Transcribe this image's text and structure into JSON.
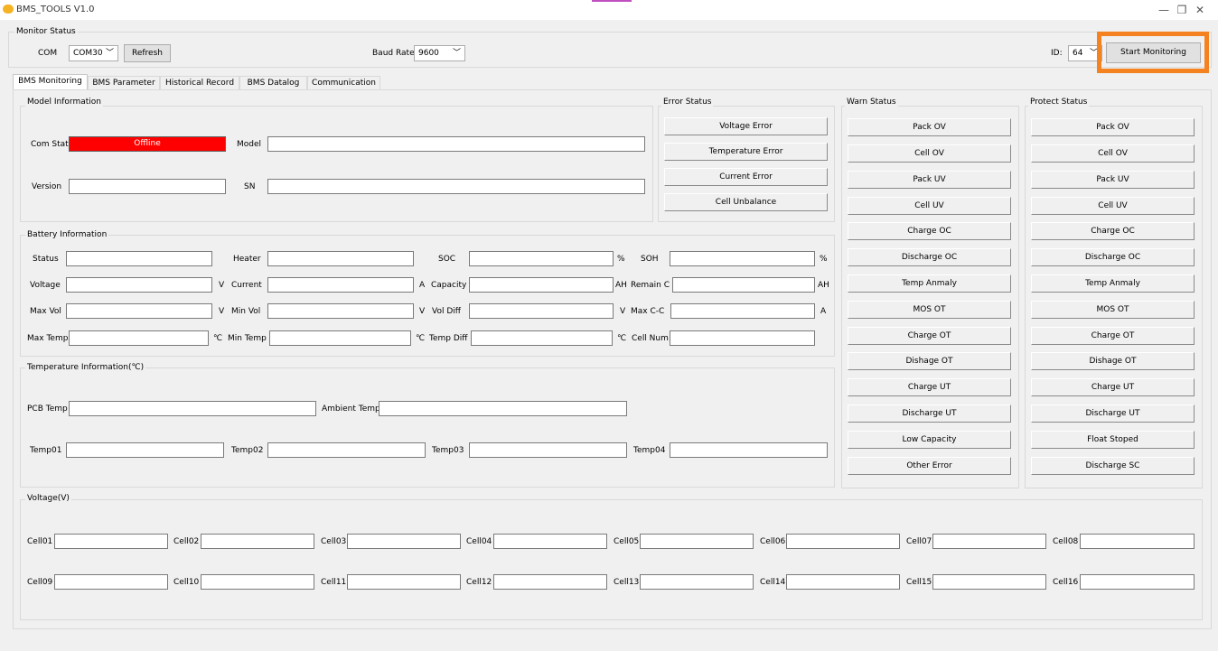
{
  "window": {
    "title": "BMS_TOOLS V1.0",
    "minimize_glyph": "—",
    "maximize_glyph": "❐",
    "close_glyph": "✕"
  },
  "monitor_status": {
    "group_title": "Monitor Status",
    "com_label": "COM",
    "com_value": "COM30",
    "refresh_label": "Refresh",
    "baud_label": "Baud Rate",
    "baud_value": "9600",
    "id_label": "ID:",
    "id_value": "64",
    "start_label": "Start Monitoring"
  },
  "tabs": [
    "BMS Monitoring",
    "BMS Parameter",
    "Historical Record",
    "BMS Datalog",
    "Communication"
  ],
  "model_info": {
    "title": "Model Information",
    "com_state_label": "Com State",
    "com_state_value": "Offline",
    "model_label": "Model",
    "version_label": "Version",
    "sn_label": "SN"
  },
  "error_status": {
    "title": "Error Status",
    "items": [
      "Voltage Error",
      "Temperature Error",
      "Current Error",
      "Cell Unbalance"
    ]
  },
  "warn_status": {
    "title": "Warn Status",
    "items": [
      "Pack OV",
      "Cell OV",
      "Pack UV",
      "Cell UV",
      "Charge OC",
      "Discharge OC",
      "Temp Anmaly",
      "MOS OT",
      "Charge OT",
      "Dishage OT",
      "Charge UT",
      "Discharge UT",
      "Low Capacity",
      "Other Error"
    ]
  },
  "protect_status": {
    "title": "Protect Status",
    "items": [
      "Pack OV",
      "Cell OV",
      "Pack UV",
      "Cell UV",
      "Charge OC",
      "Discharge OC",
      "Temp Anmaly",
      "MOS OT",
      "Charge OT",
      "Dishage OT",
      "Charge UT",
      "Discharge UT",
      "Float Stoped",
      "Discharge SC"
    ]
  },
  "battery_info": {
    "title": "Battery Information",
    "rows": [
      [
        {
          "label": "Status",
          "unit": ""
        },
        {
          "label": "Heater",
          "unit": ""
        },
        {
          "label": "SOC",
          "unit": "%"
        },
        {
          "label": "SOH",
          "unit": "%"
        }
      ],
      [
        {
          "label": "Voltage",
          "unit": "V"
        },
        {
          "label": "Current",
          "unit": "A"
        },
        {
          "label": "Capacity",
          "unit": "AH"
        },
        {
          "label": "Remain C",
          "unit": "AH"
        }
      ],
      [
        {
          "label": "Max Vol",
          "unit": "V"
        },
        {
          "label": "Min Vol",
          "unit": "V"
        },
        {
          "label": "Vol Diff",
          "unit": "V"
        },
        {
          "label": "Max C-C",
          "unit": "A"
        }
      ],
      [
        {
          "label": "Max Temp",
          "unit": "℃"
        },
        {
          "label": "Min Temp",
          "unit": "℃"
        },
        {
          "label": "Temp Diff",
          "unit": "℃"
        },
        {
          "label": "Cell Num",
          "unit": ""
        }
      ]
    ]
  },
  "temperature_info": {
    "title": "Temperature Information(℃)",
    "pcb_label": "PCB Temp",
    "ambient_label": "Ambient Temp",
    "temps": [
      "Temp01",
      "Temp02",
      "Temp03",
      "Temp04"
    ]
  },
  "voltage": {
    "title": "Voltage(V)",
    "cells": [
      "Cell01",
      "Cell02",
      "Cell03",
      "Cell04",
      "Cell05",
      "Cell06",
      "Cell07",
      "Cell08",
      "Cell09",
      "Cell10",
      "Cell11",
      "Cell12",
      "Cell13",
      "Cell14",
      "Cell15",
      "Cell16"
    ]
  },
  "colors": {
    "offline_bg": "#ff0000",
    "highlight": "#f58220"
  }
}
